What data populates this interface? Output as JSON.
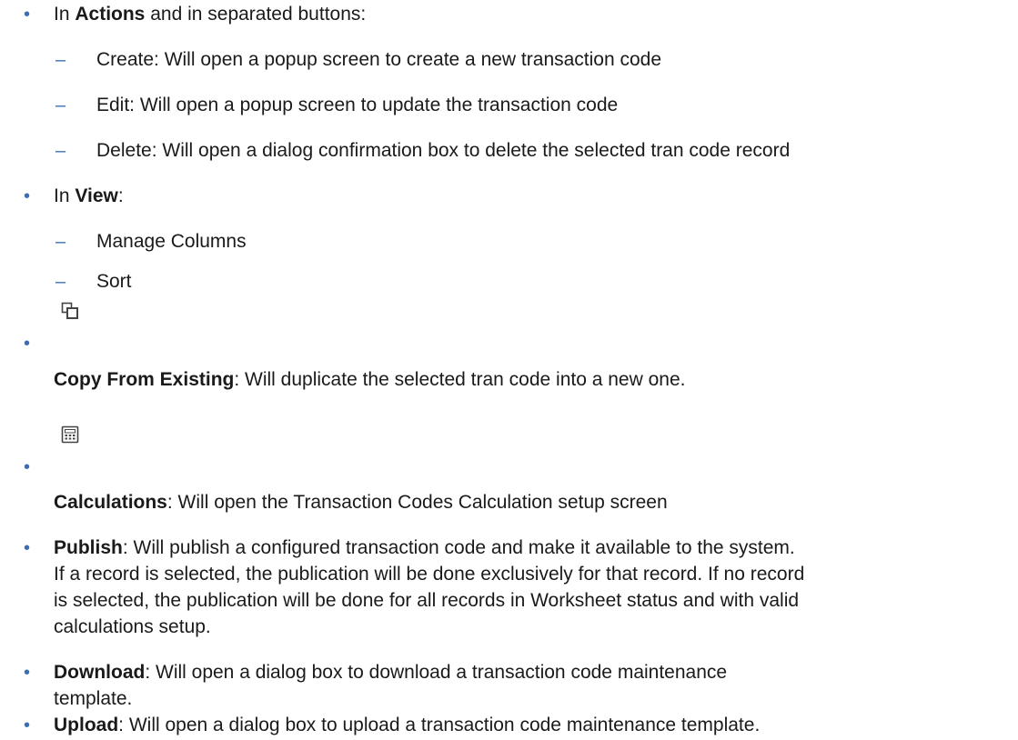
{
  "accent_color": "#3a6fb6",
  "items": {
    "actions_intro": {
      "prefix": "In ",
      "bold": "Actions",
      "suffix": " and in separated buttons:"
    },
    "create": "Create: Will open a popup screen to create a new transaction code",
    "edit": "Edit: Will open a popup screen to update the transaction code",
    "delete": "Delete: Will open a dialog confirmation box to delete the selected tran code record",
    "view_intro": {
      "prefix": "In ",
      "bold": "View",
      "suffix": ":"
    },
    "manage_columns": "Manage Columns",
    "sort": "Sort",
    "copy": {
      "icon": "copy-icon",
      "bold": "Copy From Existing",
      "text": ": Will duplicate the selected tran code into a new one."
    },
    "calculations": {
      "icon": "calculator-icon",
      "bold": "Calculations",
      "text": ": Will open the Transaction Codes Calculation setup screen"
    },
    "publish": {
      "bold": "Publish",
      "lines": [
        ": Will publish a configured transaction code and make it available to the system.",
        "If a record is selected, the publication will be done exclusively for that record. If no record",
        "is selected, the publication will be done for all records in Worksheet status and with valid",
        "calculations setup."
      ]
    },
    "download": {
      "bold": "Download",
      "lines": [
        ": Will open a dialog box to download a transaction code maintenance",
        "template."
      ]
    },
    "upload": {
      "bold": "Upload",
      "text": ": Will open a dialog box to upload a transaction code maintenance template."
    }
  }
}
